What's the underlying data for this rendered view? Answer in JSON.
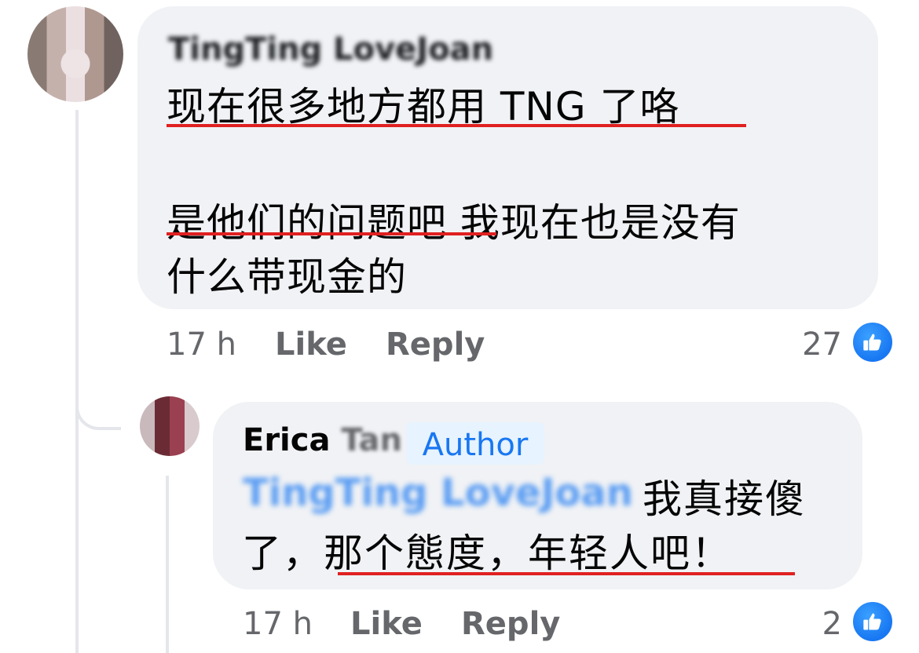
{
  "comment": {
    "author_name": "TingTing LoveJoan",
    "lines": [
      "现在很多地方都用 TNG 了咯",
      "是他们的问题吧 我现在也是没有",
      "什么带现金的"
    ],
    "time": "17 h",
    "like_label": "Like",
    "reply_label": "Reply",
    "reaction_count": "27"
  },
  "reply": {
    "author_first": "Erica",
    "author_last": "Tan",
    "badge": "Author",
    "mention": "TingTing LoveJoan",
    "line1": "我真接傻",
    "line2": "了，那个態度，年轻人吧！",
    "time": "17 h",
    "like_label": "Like",
    "reply_label": "Reply",
    "reaction_count": "2"
  },
  "colors": {
    "bubble": "#f0f2f5",
    "underline": "#e02020",
    "accent": "#1877f2",
    "muted_text": "#65676b"
  },
  "icons": {
    "reaction": "like-thumb-icon"
  }
}
